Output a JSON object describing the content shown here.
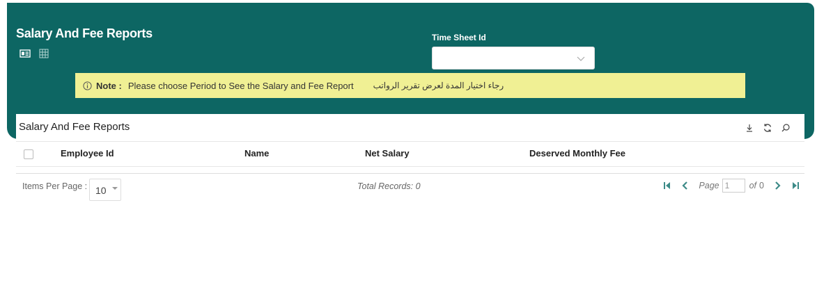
{
  "header": {
    "title": "Salary And Fee Reports",
    "time_sheet_label": "Time Sheet Id",
    "time_sheet_value": ""
  },
  "note": {
    "label": "Note :",
    "message": "Please choose Period to See the Salary and Fee Report",
    "message_ar": "رجاء اختيار المدة لعرض تقرير الرواتب"
  },
  "grid": {
    "title": "Salary And Fee Reports",
    "columns": [
      "Employee Id",
      "Name",
      "Net Salary",
      "Deserved Monthly Fee"
    ],
    "rows": []
  },
  "footer": {
    "items_per_page_label": "Items Per Page :",
    "items_per_page_value": "10",
    "total_records": "Total Records: 0",
    "page_label": "Page",
    "page_value": "1",
    "of_label": "of",
    "page_count": "0"
  },
  "colors": {
    "banner": "#0d6663",
    "note_bg": "#f0f094",
    "pager_icon": "#3d8b88"
  },
  "icons": [
    "card-view-icon",
    "grid-view-icon",
    "chevron-down-icon",
    "info-icon",
    "download-icon",
    "refresh-icon",
    "search-icon",
    "first-page-icon",
    "prev-page-icon",
    "next-page-icon",
    "last-page-icon"
  ]
}
